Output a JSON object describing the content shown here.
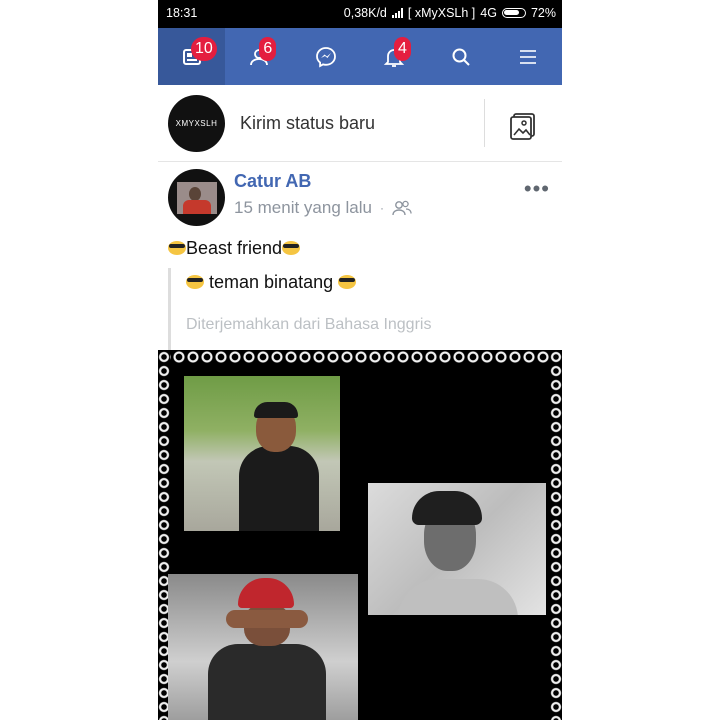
{
  "status_bar": {
    "time": "18:31",
    "speed": "0,38K/d",
    "carrier": "[ xMyXSLh ]",
    "network": "4G",
    "battery": "72%"
  },
  "nav": {
    "tabs": [
      {
        "name": "news-feed",
        "icon": "news-feed-icon",
        "badge": "10",
        "active": true
      },
      {
        "name": "friend-requests",
        "icon": "friends-icon",
        "badge": "6"
      },
      {
        "name": "messenger",
        "icon": "messenger-icon"
      },
      {
        "name": "notifications",
        "icon": "bell-icon",
        "badge": "4"
      },
      {
        "name": "search",
        "icon": "search-icon"
      },
      {
        "name": "menu",
        "icon": "menu-icon"
      }
    ],
    "colors": {
      "bar": "#4267b2",
      "badge": "#e41e3f"
    }
  },
  "composer": {
    "avatar_text": "XMYXSLH",
    "prompt": "Kirim status baru",
    "photo_icon": "photo-icon"
  },
  "post": {
    "author": "Catur AB",
    "time": "15 menit yang lalu",
    "separator": "·",
    "audience_icon": "friends-audience-icon",
    "more": "•••",
    "text": "Beast friend",
    "translation": "teman binatang",
    "translation_note": "Diterjemahkan dari Bahasa Inggris"
  }
}
